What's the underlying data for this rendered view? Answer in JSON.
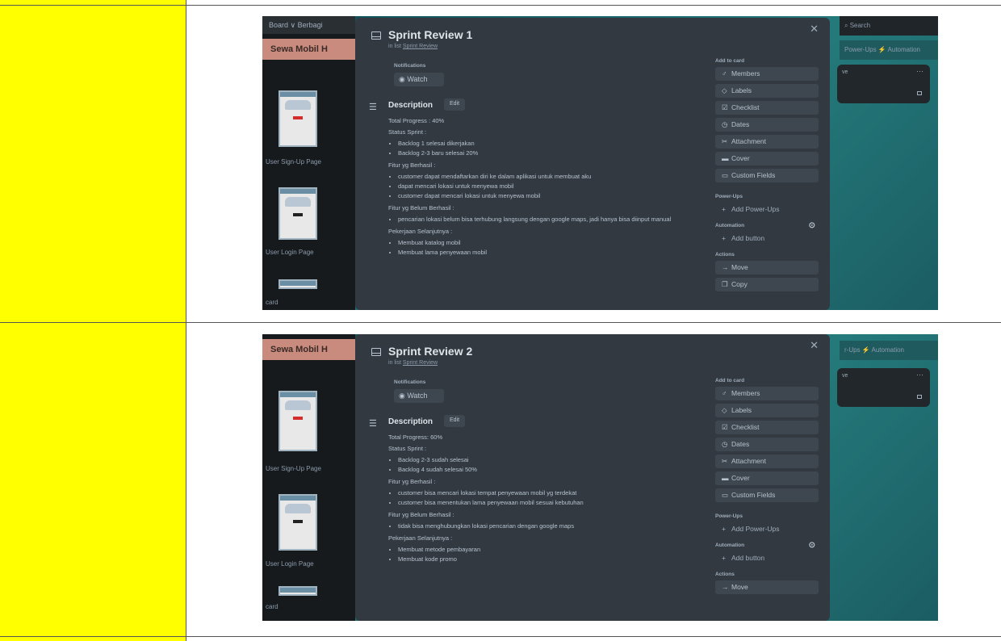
{
  "colors": {
    "sidebar_column": "#ffff00",
    "modal_bg": "#323940",
    "board_title_bg": "#c98b7d"
  },
  "screenshots": [
    {
      "board": {
        "header_text": "Board  ∨   Berbagi",
        "title": "Sewa Mobil H",
        "labels": [
          "User Sign-Up Page",
          "User Login Page",
          "card"
        ],
        "right_top": "Power-Ups   ⚡ Automation",
        "search": "⌕ Search",
        "right_card_label": "ve",
        "right_card_dots": "···"
      },
      "modal": {
        "title": "Sprint Review 1",
        "in_list_prefix": "in list ",
        "in_list_name": "Sprint Review",
        "notifications_label": "Notifications",
        "watch_label": "Watch",
        "description_heading": "Description",
        "edit_label": "Edit",
        "description": [
          {
            "type": "p",
            "text": "Total Progress : 40%"
          },
          {
            "type": "p",
            "text": "Status Sprint :"
          },
          {
            "type": "ul",
            "items": [
              "Backlog 1 selesai dikerjakan",
              "Backlog 2-3 baru selesai 20%"
            ]
          },
          {
            "type": "p",
            "text": "Fitur yg Berhasil :"
          },
          {
            "type": "ul",
            "items": [
              "customer dapat mendaftarkan diri ke dalam aplikasi untuk membuat aku",
              "dapat mencari lokasi untuk menyewa mobil",
              "customer dapat mencari lokasi untuk menyewa mobil"
            ]
          },
          {
            "type": "p",
            "text": "Fitur yg Belum Berhasil :"
          },
          {
            "type": "ul",
            "items": [
              "pencarian lokasi belum bisa terhubung langsung dengan google maps, jadi hanya bisa diinput manual"
            ]
          },
          {
            "type": "p",
            "text": "Pekerjaan Selanjutnya :"
          },
          {
            "type": "ul",
            "items": [
              "Membuat katalog mobil",
              "Membuat lama penyewaan mobil"
            ]
          }
        ],
        "add_to_card_label": "Add to card",
        "add_to_card": [
          {
            "icon": "♂",
            "icon_name": "members-icon",
            "label": "Members"
          },
          {
            "icon": "◇",
            "icon_name": "label-icon",
            "label": "Labels"
          },
          {
            "icon": "☑",
            "icon_name": "checklist-icon",
            "label": "Checklist"
          },
          {
            "icon": "◷",
            "icon_name": "clock-icon",
            "label": "Dates"
          },
          {
            "icon": "✂",
            "icon_name": "paperclip-icon",
            "label": "Attachment"
          },
          {
            "icon": "▬",
            "icon_name": "cover-icon",
            "label": "Cover"
          },
          {
            "icon": "▭",
            "icon_name": "custom-fields-icon",
            "label": "Custom Fields"
          }
        ],
        "powerups_label": "Power-Ups",
        "add_powerups": "Add Power-Ups",
        "automation_label": "Automation",
        "add_button": "Add button",
        "actions_label": "Actions",
        "actions": [
          {
            "icon": "→",
            "icon_name": "arrow-right-icon",
            "label": "Move"
          },
          {
            "icon": "❐",
            "icon_name": "copy-icon",
            "label": "Copy"
          }
        ]
      }
    },
    {
      "board": {
        "header_text": "",
        "title": "Sewa Mobil H",
        "labels": [
          "User Sign-Up Page",
          "User Login Page",
          "card"
        ],
        "right_top": "r-Ups   ⚡ Automation",
        "search": "",
        "right_card_label": "ve",
        "right_card_dots": "···"
      },
      "modal": {
        "title": "Sprint Review 2",
        "in_list_prefix": "in list ",
        "in_list_name": "Sprint Review",
        "notifications_label": "Notifications",
        "watch_label": "Watch",
        "description_heading": "Description",
        "edit_label": "Edit",
        "description": [
          {
            "type": "p",
            "text": "Total Progress: 60%"
          },
          {
            "type": "p",
            "text": "Status Sprint :"
          },
          {
            "type": "ul",
            "items": [
              "Backlog 2-3 sudah selesai",
              "Backlog 4 sudah selesai 50%"
            ]
          },
          {
            "type": "p",
            "text": "Fitur yg Berhasil :"
          },
          {
            "type": "ul",
            "items": [
              "customer bisa mencari lokasi tempat penyewaan mobil yg terdekat",
              "customer bisa menentukan lama penyewaan mobil sesuai kebutuhan"
            ]
          },
          {
            "type": "p",
            "text": "Fitur yg Belum Berhasil :"
          },
          {
            "type": "ul",
            "items": [
              "tidak bisa menghubungkan lokasi pencarian dengan google maps"
            ]
          },
          {
            "type": "p",
            "text": "Pekerjaan Selanjutnya :"
          },
          {
            "type": "ul",
            "items": [
              "Membuat metode pembayaran",
              "Membuat kode promo"
            ]
          }
        ],
        "add_to_card_label": "Add to card",
        "add_to_card": [
          {
            "icon": "♂",
            "icon_name": "members-icon",
            "label": "Members"
          },
          {
            "icon": "◇",
            "icon_name": "label-icon",
            "label": "Labels"
          },
          {
            "icon": "☑",
            "icon_name": "checklist-icon",
            "label": "Checklist"
          },
          {
            "icon": "◷",
            "icon_name": "clock-icon",
            "label": "Dates"
          },
          {
            "icon": "✂",
            "icon_name": "paperclip-icon",
            "label": "Attachment"
          },
          {
            "icon": "▬",
            "icon_name": "cover-icon",
            "label": "Cover"
          },
          {
            "icon": "▭",
            "icon_name": "custom-fields-icon",
            "label": "Custom Fields"
          }
        ],
        "powerups_label": "Power-Ups",
        "add_powerups": "Add Power-Ups",
        "automation_label": "Automation",
        "add_button": "Add button",
        "actions_label": "Actions",
        "actions": [
          {
            "icon": "→",
            "icon_name": "arrow-right-icon",
            "label": "Move"
          }
        ]
      }
    }
  ]
}
